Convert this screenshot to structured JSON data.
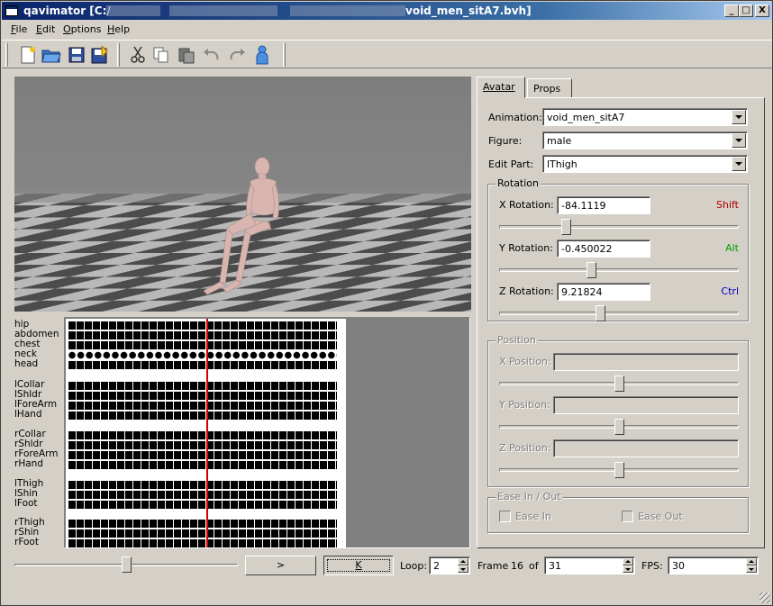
{
  "window": {
    "title_prefix": "qavimator [C:/",
    "title_suffix": "void_men_sitA7.bvh]",
    "minimize": "_",
    "maximize": "□",
    "close": "X"
  },
  "menu": [
    "File",
    "Edit",
    "Options",
    "Help"
  ],
  "menu_accel": [
    "F",
    "E",
    "O",
    "H"
  ],
  "toolbar": [
    "new-file-icon",
    "open-folder-icon",
    "save-icon",
    "save-as-icon",
    "cut-icon",
    "copy-icon",
    "paste-icon",
    "undo-icon",
    "redo-icon",
    "avatar-icon"
  ],
  "parts": [
    "hip",
    "abdomen",
    "chest",
    "neck",
    "head",
    "lCollar",
    "lShldr",
    "lForeArm",
    "lHand",
    "rCollar",
    "rShldr",
    "rForeArm",
    "rHand",
    "lThigh",
    "lShin",
    "lFoot",
    "rThigh",
    "rShin",
    "rFoot"
  ],
  "tabs": {
    "avatar": "Avatar",
    "props": "Props"
  },
  "panel": {
    "animation_label": "Animation:",
    "animation_value": "void_men_sitA7",
    "figure_label": "Figure:",
    "figure_value": "male",
    "editpart_label": "Edit Part:",
    "editpart_value": "lThigh",
    "rotation": {
      "title": "Rotation",
      "x_label": "X Rotation:",
      "x_value": "-84.1119",
      "x_mod": "Shift",
      "x_slider": 0.27,
      "y_label": "Y Rotation:",
      "y_value": "-0.450022",
      "y_mod": "Alt",
      "y_slider": 0.38,
      "z_label": "Z Rotation:",
      "z_value": "9.21824",
      "z_mod": "Ctrl",
      "z_slider": 0.42
    },
    "position": {
      "title": "Position",
      "x_label": "X Position:",
      "x_slider": 0.5,
      "y_label": "Y Position:",
      "y_slider": 0.5,
      "z_label": "Z Position:",
      "z_slider": 0.5
    },
    "ease": {
      "title": "Ease In / Out",
      "in": "Ease In",
      "out": "Ease Out"
    }
  },
  "bottom": {
    "play": ">",
    "key": "K",
    "loop_label": "Loop:",
    "loop_value": "2",
    "frame_label": "Frame",
    "frame_value": "16",
    "of_label": "of",
    "total_value": "31",
    "fps_label": "FPS:",
    "fps_value": "30",
    "scrub_position": 0.5
  },
  "colors": {
    "shift": "#b00000",
    "alt": "#00a000",
    "ctrl": "#0000c0",
    "cursor": "#d00000"
  }
}
